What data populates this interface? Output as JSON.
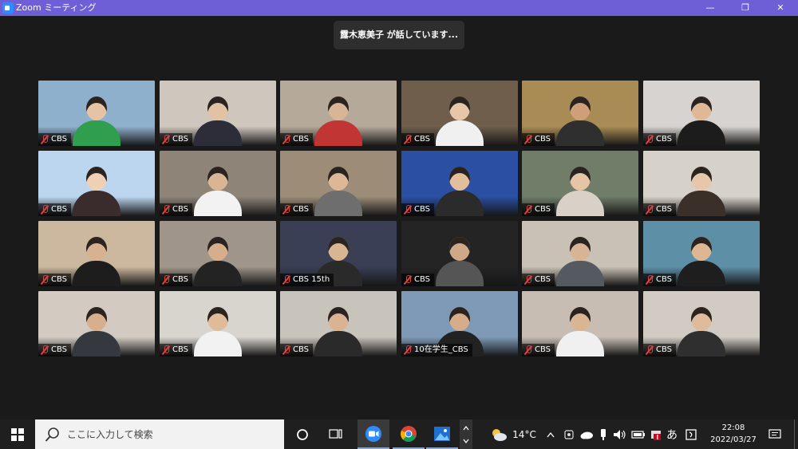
{
  "window": {
    "title": "Zoom ミーティング"
  },
  "speaker_banner": "露木恵美子 が話しています...",
  "participants": [
    {
      "name": "CBS",
      "bg": "#8fb0cc",
      "face": "#e6c3a4",
      "shirt": "#2f9e4f"
    },
    {
      "name": "CBS",
      "bg": "#cfc7bd",
      "face": "#e3c1a3",
      "shirt": "#2d2d3a"
    },
    {
      "name": "CBS",
      "bg": "#b5a99a",
      "face": "#d9b495",
      "shirt": "#c23535"
    },
    {
      "name": "CBS",
      "bg": "#6f5e4b",
      "face": "#e8c7a9",
      "shirt": "#f0f0f0"
    },
    {
      "name": "CBS",
      "bg": "#a98c55",
      "face": "#cf9f7a",
      "shirt": "#2f2f2f"
    },
    {
      "name": "CBS",
      "bg": "#d6d3d0",
      "face": "#e0b896",
      "shirt": "#1c1c1c"
    },
    {
      "name": "CBS",
      "bg": "#bcd6ef",
      "face": "#efd0b5",
      "shirt": "#3a2c2c"
    },
    {
      "name": "CBS",
      "bg": "#8e8578",
      "face": "#d9b594",
      "shirt": "#f2f2f2"
    },
    {
      "name": "CBS",
      "bg": "#9c8c78",
      "face": "#dcb896",
      "shirt": "#6e6e6e"
    },
    {
      "name": "CBS",
      "bg": "#2a4fa3",
      "face": "#e2be9c",
      "shirt": "#2b2b2b"
    },
    {
      "name": "CBS",
      "bg": "#6f7d69",
      "face": "#e6c4a6",
      "shirt": "#d9d0c7"
    },
    {
      "name": "CBS",
      "bg": "#d7d2c9",
      "face": "#e7c7aa",
      "shirt": "#3b2f2a"
    },
    {
      "name": "CBS",
      "bg": "#cbb89e",
      "face": "#d8b190",
      "shirt": "#1d1d1d"
    },
    {
      "name": "CBS",
      "bg": "#9f958a",
      "face": "#d6ae8c",
      "shirt": "#232323"
    },
    {
      "name": "CBS 15th",
      "bg": "#3a3f55",
      "face": "#dab592",
      "shirt": "#2a2a2a"
    },
    {
      "name": "CBS",
      "bg": "#242424",
      "face": "#cfa888",
      "shirt": "#555555"
    },
    {
      "name": "CBS",
      "bg": "#c9c1b5",
      "face": "#d9b494",
      "shirt": "#555960"
    },
    {
      "name": "CBS",
      "bg": "#5d8fa6",
      "face": "#ddb794",
      "shirt": "#1e1e1e"
    },
    {
      "name": "CBS",
      "bg": "#d3cbc2",
      "face": "#d7af8d",
      "shirt": "#36383f"
    },
    {
      "name": "CBS",
      "bg": "#d8d5cf",
      "face": "#e0bb99",
      "shirt": "#f2f2f2"
    },
    {
      "name": "CBS",
      "bg": "#c9c4bb",
      "face": "#d9b392",
      "shirt": "#2a2a2a"
    },
    {
      "name": "10在学生_CBS",
      "bg": "#7f9ab6",
      "face": "#d6ad8b",
      "shirt": "#222222"
    },
    {
      "name": "CBS",
      "bg": "#c8bdb3",
      "face": "#dab593",
      "shirt": "#f0f0f0"
    },
    {
      "name": "CBS",
      "bg": "#d1cbc4",
      "face": "#e0bb9b",
      "shirt": "#2f2f2f"
    }
  ],
  "taskbar": {
    "search_placeholder": "ここに入力して検索",
    "weather": "14°C",
    "ime": "あ",
    "time": "22:08",
    "date": "2022/03/27",
    "apps": [
      "cortana-icon",
      "task-view-icon",
      "zoom-icon",
      "chrome-icon",
      "photos-icon"
    ]
  },
  "colors": {
    "titlebar": "#6e5fd6",
    "zoom_blue": "#2d8cff",
    "muted_red": "#e04040"
  }
}
